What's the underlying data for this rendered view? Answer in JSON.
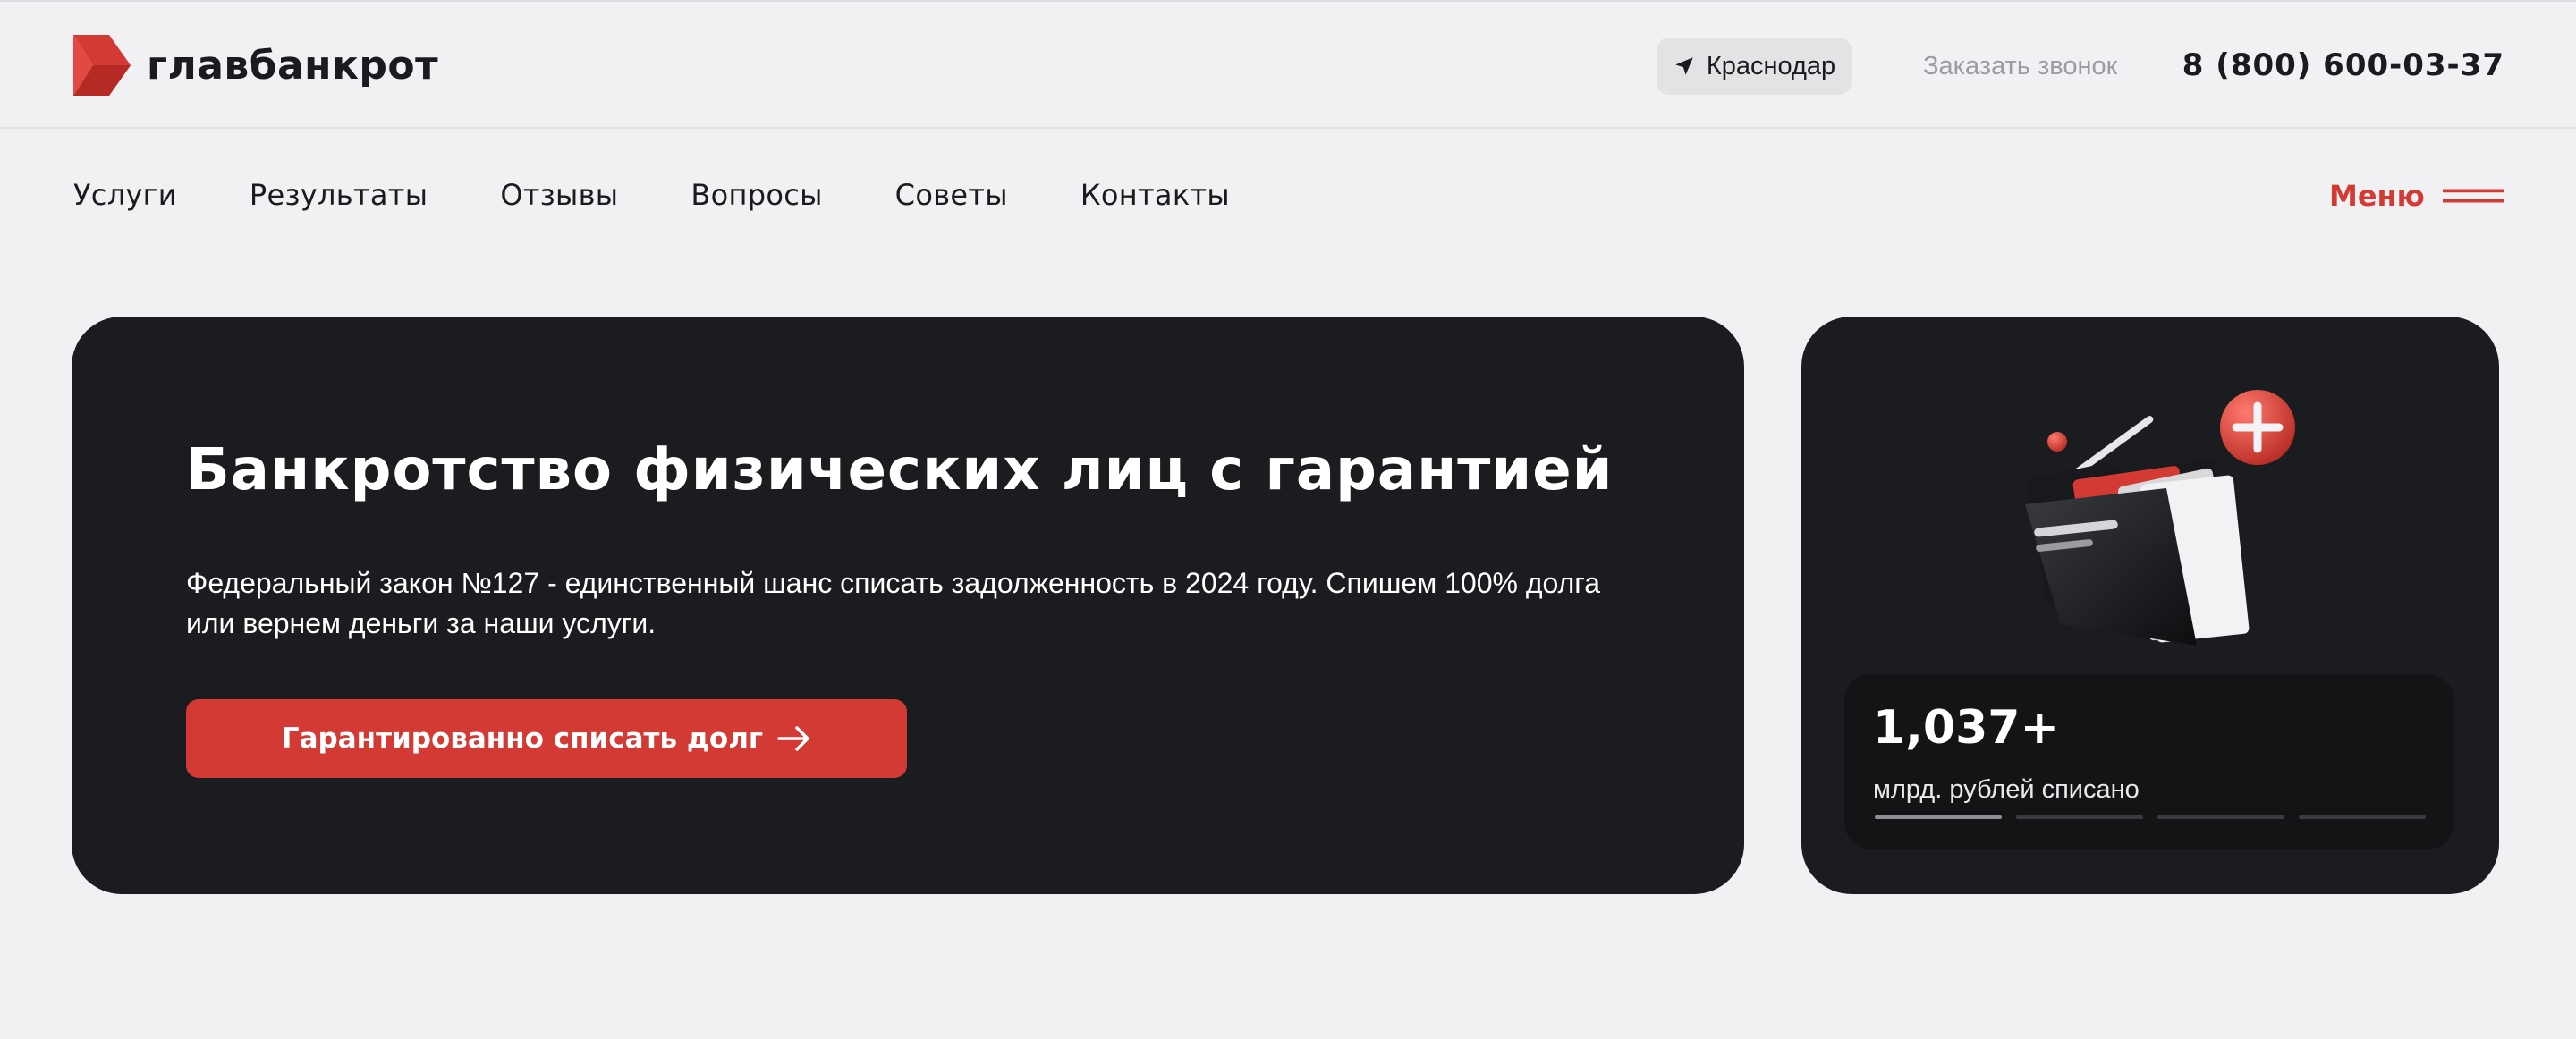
{
  "header": {
    "logo_text": "главбанкрот",
    "city": "Краснодар",
    "callback_label": "Заказать звонок",
    "phone": "8 (800) 600-03-37"
  },
  "nav": {
    "items": [
      {
        "label": "Услуги"
      },
      {
        "label": "Результаты"
      },
      {
        "label": "Отзывы"
      },
      {
        "label": "Вопросы"
      },
      {
        "label": "Советы"
      },
      {
        "label": "Контакты"
      }
    ],
    "menu_label": "Меню"
  },
  "hero": {
    "title": "Банкротство физических лиц с гарантией",
    "description": "Федеральный закон №127 - единственный шанс списать задолженность в 2024 году. Спишем 100% долга или вернем деньги за наши услуги.",
    "cta_label": "Гарантированно списать долг"
  },
  "stats": {
    "value": "1,037+",
    "caption": "млрд. рублей списано",
    "slides_total": 4,
    "slide_active": 1
  },
  "colors": {
    "brand_red": "#d23a33",
    "card_dark": "#1b1c1f",
    "page_bg": "#f1f1f3",
    "muted_text": "#9a9ca3"
  },
  "icons": {
    "logo": "logo-mark-icon",
    "city": "location-arrow-icon",
    "menu": "hamburger-icon",
    "cta": "arrow-right-icon",
    "illustration": "folder-documents-icon"
  }
}
